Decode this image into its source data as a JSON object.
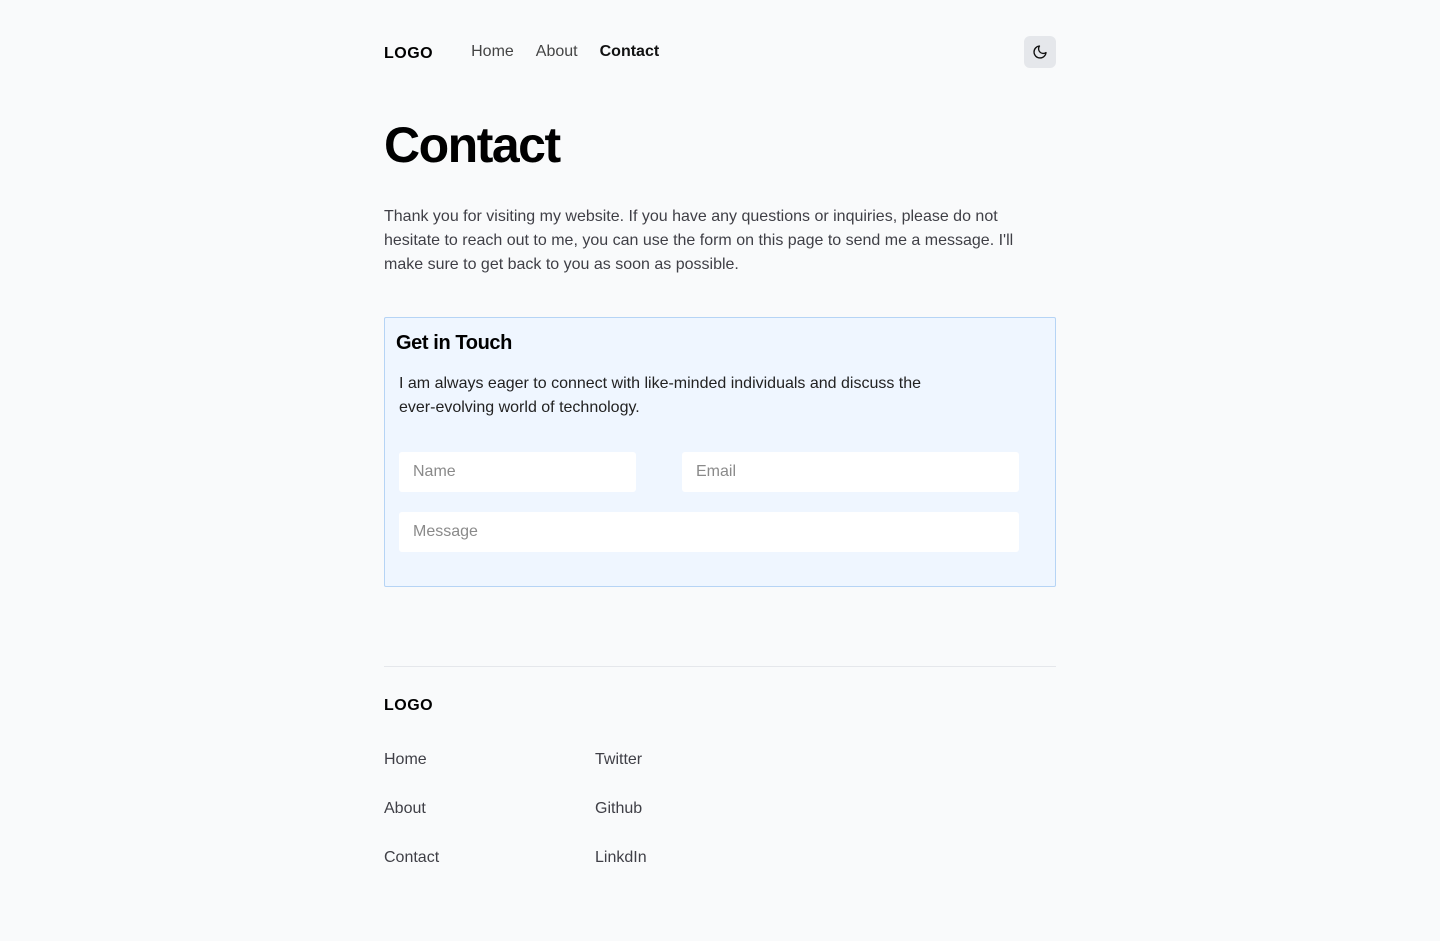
{
  "header": {
    "logo": "LOGO",
    "nav": [
      {
        "label": "Home"
      },
      {
        "label": "About"
      },
      {
        "label": "Contact"
      }
    ],
    "active_nav": "Contact",
    "theme_toggle_icon": "moon-icon"
  },
  "main": {
    "title": "Contact",
    "intro": "Thank you for visiting my website. If you have any questions or inquiries, please do not hesitate to reach out to me, you can use the form on this page to send me a message. I'll make sure to get back to you as soon as possible."
  },
  "contact_card": {
    "title": "Get in Touch",
    "description_line1": "I am always eager to connect with like-minded individuals and discuss the",
    "description_line2": "ever-evolving world of technology.",
    "name_placeholder": "Name",
    "email_placeholder": "Email",
    "message_placeholder": "Message",
    "accent_border": "#b6d4f5",
    "background": "#eff6ff"
  },
  "footer": {
    "logo": "LOGO",
    "pages": [
      {
        "label": "Home"
      },
      {
        "label": "About"
      },
      {
        "label": "Contact"
      }
    ],
    "social": [
      {
        "label": "Twitter"
      },
      {
        "label": "Github"
      },
      {
        "label": "LinkdIn"
      }
    ]
  }
}
